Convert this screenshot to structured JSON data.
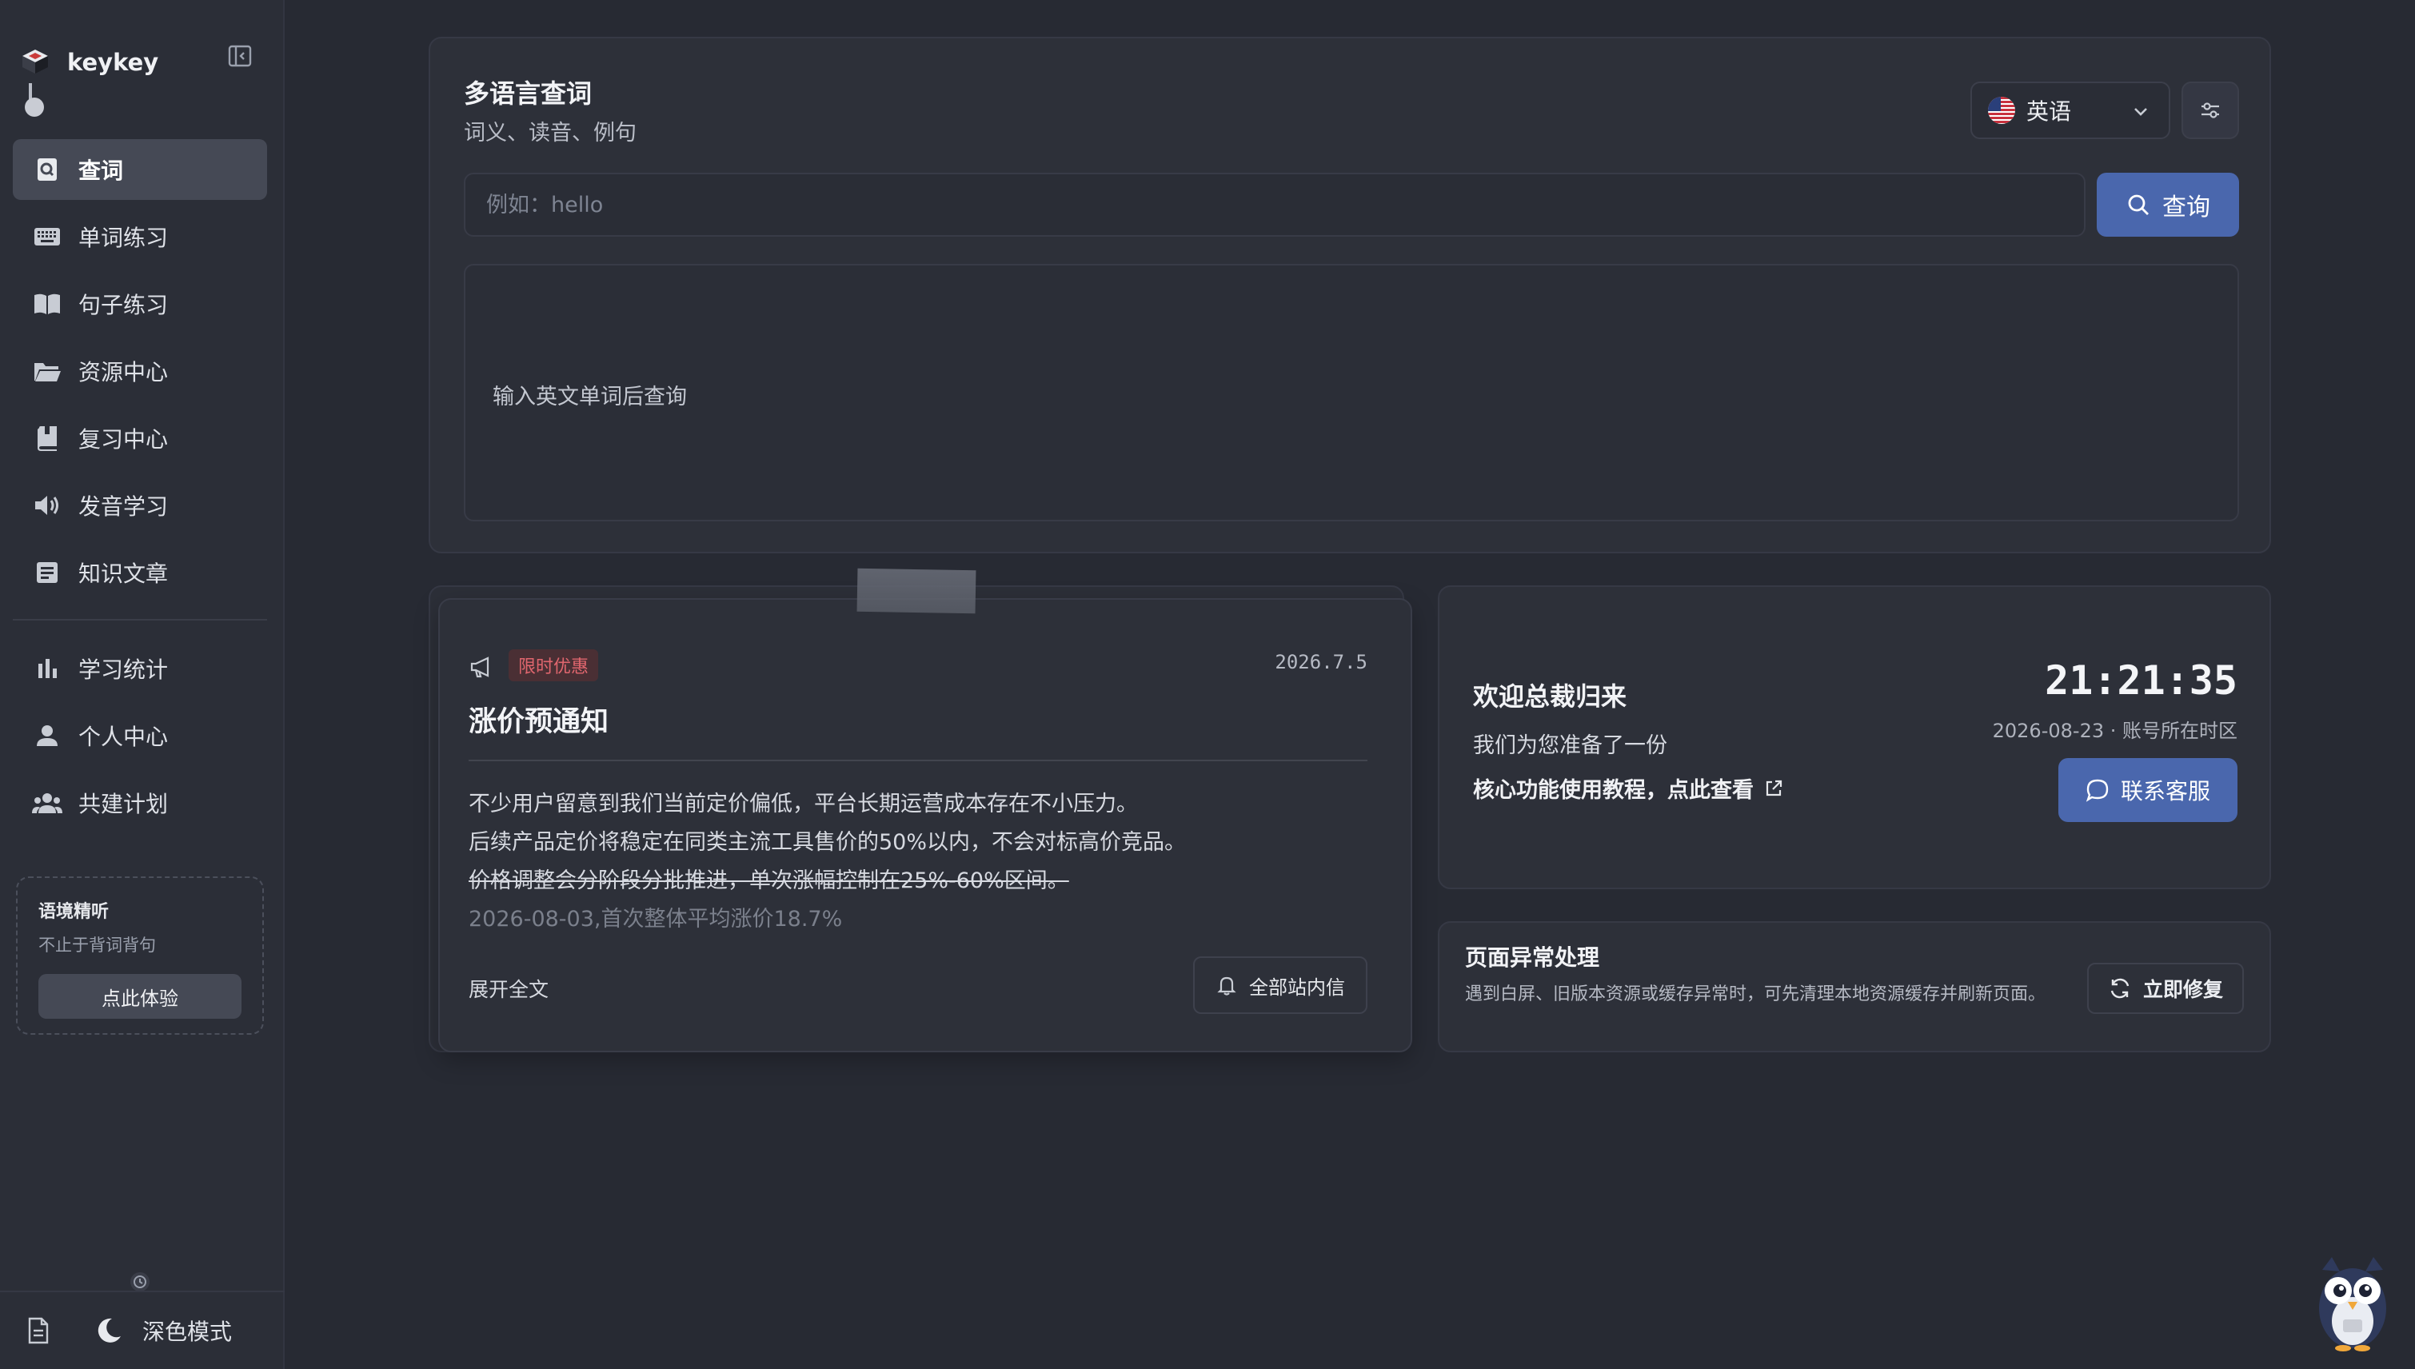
{
  "sidebar": {
    "brand": "keykey",
    "nav": [
      {
        "label": "查词",
        "icon": "search-doc-icon",
        "active": true
      },
      {
        "label": "单词练习",
        "icon": "keyboard-icon"
      },
      {
        "label": "句子练习",
        "icon": "book-open-icon"
      },
      {
        "label": "资源中心",
        "icon": "folder-icon"
      },
      {
        "label": "复习中心",
        "icon": "book-icon"
      },
      {
        "label": "发音学习",
        "icon": "speaker-icon"
      },
      {
        "label": "知识文章",
        "icon": "article-icon"
      }
    ],
    "nav2": [
      {
        "label": "学习统计",
        "icon": "bar-chart-icon"
      },
      {
        "label": "个人中心",
        "icon": "person-icon"
      },
      {
        "label": "共建计划",
        "icon": "group-icon"
      }
    ],
    "promo": {
      "title": "语境精听",
      "subtitle": "不止于背词背句",
      "button": "点此体验"
    },
    "theme_label": "深色模式"
  },
  "search": {
    "title": "多语言查词",
    "subtitle": "词义、读音、例句",
    "language": "英语",
    "placeholder": "例如：hello",
    "button": "查询",
    "empty_hint": "输入英文单词后查询"
  },
  "notice": {
    "badge": "限时优惠",
    "date": "2026.7.5",
    "title": "涨价预通知",
    "line1": "不少用户留意到我们当前定价偏低，平台长期运营成本存在不小压力。",
    "line2": "后续产品定价将稳定在同类主流工具售价的50%以内，不会对标高价竞品。",
    "line3": "价格调整会分阶段分批推进，单次涨幅控制在25%-60%区间。",
    "line4": "2026-08-03,首次整体平均涨价18.7%",
    "expand": "展开全文",
    "all_messages": "全部站内信"
  },
  "welcome": {
    "title": "欢迎总裁归来",
    "subtitle": "我们为您准备了一份",
    "link": "核心功能使用教程，点此查看",
    "clock": "21:21:35",
    "date_line": "2026-08-23 · 账号所在时区",
    "contact": "联系客服"
  },
  "fix": {
    "title": "页面异常处理",
    "description": "遇到白屏、旧版本资源或缓存异常时，可先清理本地资源缓存并刷新页面。",
    "button": "立即修复"
  },
  "colors": {
    "accent": "#4a67ad",
    "badge_text": "#e0666e",
    "badge_bg": "#4a2f34",
    "background": "#272a33",
    "card": "#2d3039"
  }
}
